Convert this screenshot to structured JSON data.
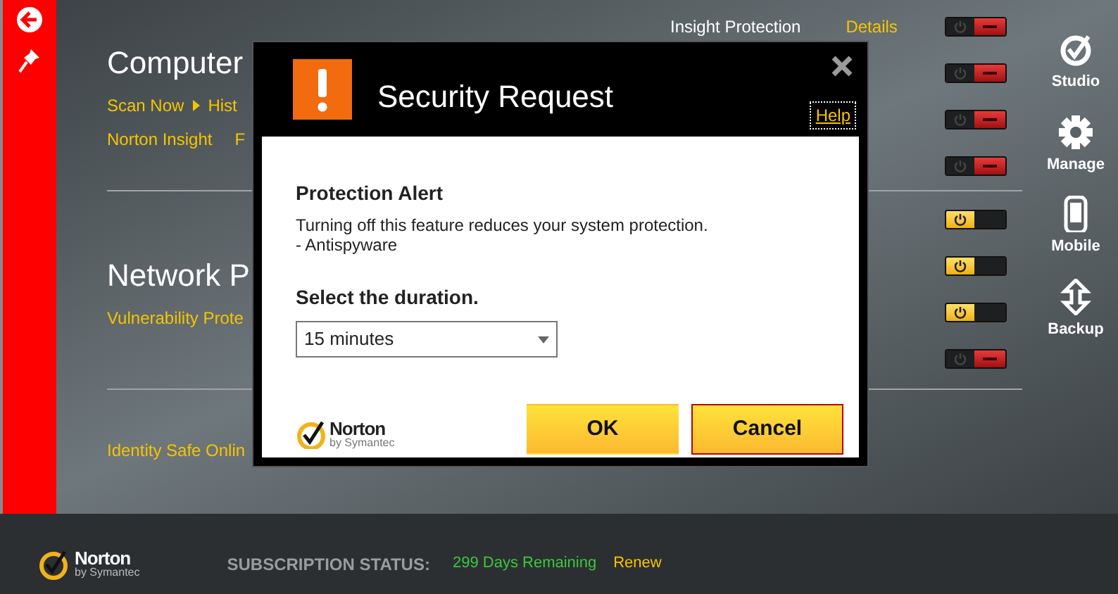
{
  "header_row": {
    "label": "Insight Protection",
    "link": "Details"
  },
  "sections": [
    {
      "title": "Computer",
      "link_rows": [
        [
          {
            "kind": "link",
            "text": "Scan Now"
          },
          {
            "kind": "arrow"
          },
          {
            "kind": "link",
            "text": "Hist"
          }
        ],
        [
          {
            "kind": "link",
            "text": "Norton Insight"
          },
          {
            "kind": "link",
            "text": "F"
          }
        ]
      ],
      "toggles": [
        {
          "on": false
        },
        {
          "on": false
        },
        {
          "on": false
        },
        {
          "on": false
        }
      ]
    },
    {
      "title": "Network P",
      "link_rows": [
        [
          {
            "kind": "link",
            "text": "Vulnerability Prote"
          }
        ]
      ],
      "toggles": [
        {
          "on": true
        },
        {
          "on": true
        },
        {
          "on": true
        },
        {
          "on": false
        }
      ]
    },
    {
      "link_rows": [
        [
          {
            "kind": "link",
            "text": "Identity Safe Onlin"
          }
        ]
      ]
    }
  ],
  "right_nav": [
    {
      "label": "Studio",
      "kind": "studio"
    },
    {
      "label": "Manage",
      "kind": "manage"
    },
    {
      "label": "Mobile",
      "kind": "mobile"
    },
    {
      "label": "Backup",
      "kind": "backup"
    }
  ],
  "dialog": {
    "title": "Security Request",
    "help": "Help",
    "heading": "Protection Alert",
    "message": "Turning off this feature reduces your system protection.",
    "feature": "- Antispyware",
    "duration_label": "Select the duration.",
    "duration": "15 minutes",
    "logo": {
      "name": "Norton",
      "sub": "by Symantec"
    },
    "buttons": [
      {
        "label": "OK",
        "focused": false
      },
      {
        "label": "Cancel",
        "focused": true
      }
    ]
  },
  "footer": {
    "logo": {
      "name": "Norton",
      "sub": "by Symantec"
    },
    "status_label": "SUBSCRIPTION STATUS:",
    "status": "299 Days Remaining",
    "renew": "Renew"
  }
}
